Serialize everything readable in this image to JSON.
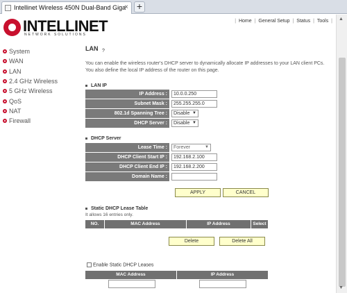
{
  "browser": {
    "tab_title": "Intellinet Wireless 450N Dual-Band Giga",
    "close_glyph": "×",
    "new_tab_glyph": "+"
  },
  "logo": {
    "name": "INTELLINET",
    "tagline": "NETWORK SOLUTIONS",
    "color": "#c8102e"
  },
  "topnav": {
    "home": "Home",
    "general_setup": "General Setup",
    "status": "Status",
    "tools": "Tools",
    "sep": "|"
  },
  "sidebar": {
    "items": [
      {
        "label": "System"
      },
      {
        "label": "WAN"
      },
      {
        "label": "LAN"
      },
      {
        "label": "2.4 GHz Wireless"
      },
      {
        "label": "5 GHz Wireless"
      },
      {
        "label": "QoS"
      },
      {
        "label": "NAT"
      },
      {
        "label": "Firewall"
      }
    ]
  },
  "main": {
    "title": "LAN",
    "description": "You can enable the wireless router's DHCP server to dynamically allocate IP addresses to your LAN client PCs. You also define the local IP address of the router on this page.",
    "lan_ip": {
      "heading": "LAN IP",
      "ip_label": "IP Address :",
      "ip_value": "10.0.0.250",
      "mask_label": "Subnet Mask :",
      "mask_value": "255.255.255.0",
      "stp_label": "802.1d Spanning Tree :",
      "stp_value": "Disable",
      "dhcp_label": "DHCP Server :",
      "dhcp_value": "Disable"
    },
    "dhcp_server": {
      "heading": "DHCP Server",
      "lease_label": "Lease Time :",
      "lease_value": "Forever",
      "start_label": "DHCP Client Start IP :",
      "start_value": "192.168.2.100",
      "end_label": "DHCP Client End IP :",
      "end_value": "192.168.2.200",
      "domain_label": "Domain Name :",
      "domain_value": ""
    },
    "apply_label": "APPLY",
    "cancel_label": "CANCEL",
    "static_table": {
      "heading": "Static DHCP Lease Table",
      "note": "It allows 16 entries only.",
      "columns": [
        "NO.",
        "MAC Address",
        "IP Address",
        "Select"
      ]
    },
    "delete_label": "Delete",
    "delete_all_label": "Delete All",
    "enable_static": {
      "label": "Enable Static DHCP Leases",
      "columns": [
        "MAC Address",
        "IP Address"
      ]
    }
  }
}
